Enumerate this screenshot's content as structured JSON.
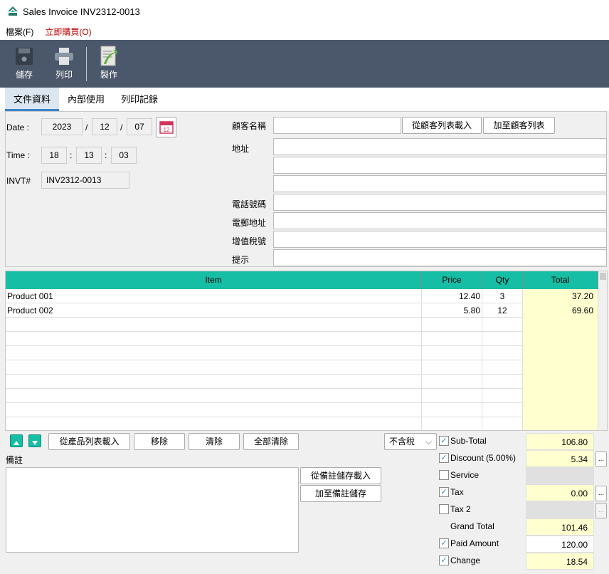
{
  "window": {
    "title": "Sales Invoice INV2312-0013"
  },
  "menu": [
    {
      "label": "檔案(F)",
      "color": "#000000"
    },
    {
      "label": "立即購買(O)",
      "color": "#c00000"
    }
  ],
  "toolbar": {
    "save": "儲存",
    "print": "列印",
    "make": "製作",
    "bg": "#4b586b"
  },
  "tabs": [
    {
      "label": "文件資料",
      "active": true
    },
    {
      "label": "內部使用"
    },
    {
      "label": "列印記錄"
    }
  ],
  "form": {
    "date_label": "Date :",
    "year": "2023",
    "month": "12",
    "day": "07",
    "sep": "/",
    "calendar_icon_text": "12",
    "time_label": "Time :",
    "hour": "18",
    "minute": "13",
    "second": "03",
    "tsep": ":",
    "invt_label": "INVT#",
    "invt": "INV2312-0013",
    "customer_label": "顧客名稱",
    "load_customer": "從顧客列表載入",
    "add_customer": "加至顧客列表",
    "address_label": "地址",
    "phone_label": "電話號碼",
    "email_label": "電郵地址",
    "vat_label": "增值稅號",
    "hint_label": "提示"
  },
  "grid": {
    "header_color": "#16bea5",
    "columns": [
      "Item",
      "Price",
      "Qty",
      "Total"
    ],
    "rows": [
      {
        "item": "Product 001",
        "price": "12.40",
        "qty": "3",
        "total": "37.20"
      },
      {
        "item": "Product 002",
        "price": "5.80",
        "qty": "12",
        "total": "69.60"
      }
    ]
  },
  "actions": {
    "load_products": "從產品列表載入",
    "remove": "移除",
    "clear": "清除",
    "clear_all": "全部清除"
  },
  "notes": {
    "label": "備註",
    "load": "從備註儲存載入",
    "save": "加至備註儲存"
  },
  "tax_mode": "不含稅",
  "summary": [
    {
      "label": "Sub-Total",
      "checked": true,
      "value": "106.80",
      "style": "yellow"
    },
    {
      "label": "Discount (5.00%)",
      "checked": true,
      "value": "5.34",
      "style": "yellow",
      "more": true
    },
    {
      "label": "Service",
      "checked": false,
      "value": "",
      "style": "grey"
    },
    {
      "label": "Tax",
      "checked": true,
      "value": "0.00",
      "style": "yellow",
      "more": true
    },
    {
      "label": "Tax 2",
      "checked": false,
      "value": "",
      "style": "grey",
      "more": true
    },
    {
      "label": "Grand Total",
      "value": "101.46",
      "style": "yellow",
      "nocheck": true
    },
    {
      "label": "Paid Amount",
      "checked": true,
      "value": "120.00",
      "style": "white"
    },
    {
      "label": "Change",
      "checked": true,
      "value": "18.54",
      "style": "yellow"
    }
  ],
  "more_label": "..."
}
